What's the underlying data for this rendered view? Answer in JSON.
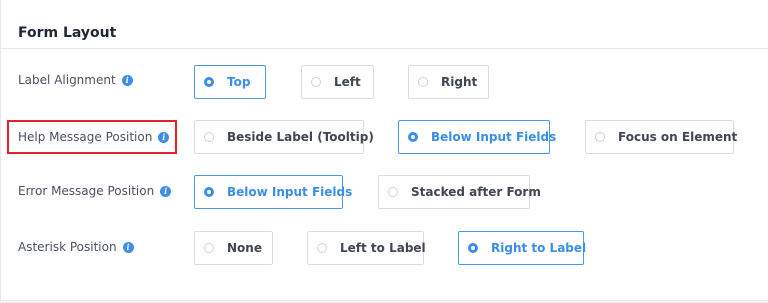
{
  "section": {
    "title": "Form Layout"
  },
  "rows": [
    {
      "label": "Label Alignment",
      "options": [
        "Top",
        "Left",
        "Right"
      ],
      "selected": "Top"
    },
    {
      "label": "Help Message Position",
      "options": [
        "Beside Label (Tooltip)",
        "Below Input Fields",
        "Focus on Element"
      ],
      "selected": "Below Input Fields"
    },
    {
      "label": "Error Message Position",
      "options": [
        "Below Input Fields",
        "Stacked after Form"
      ],
      "selected": "Below Input Fields"
    },
    {
      "label": "Asterisk Position",
      "options": [
        "None",
        "Left to Label",
        "Right to Label"
      ],
      "selected": "Right to Label"
    }
  ],
  "colors": {
    "accent": "#3b8ee6",
    "highlight": "#e0222b"
  },
  "icons": {
    "info": "info-icon"
  }
}
